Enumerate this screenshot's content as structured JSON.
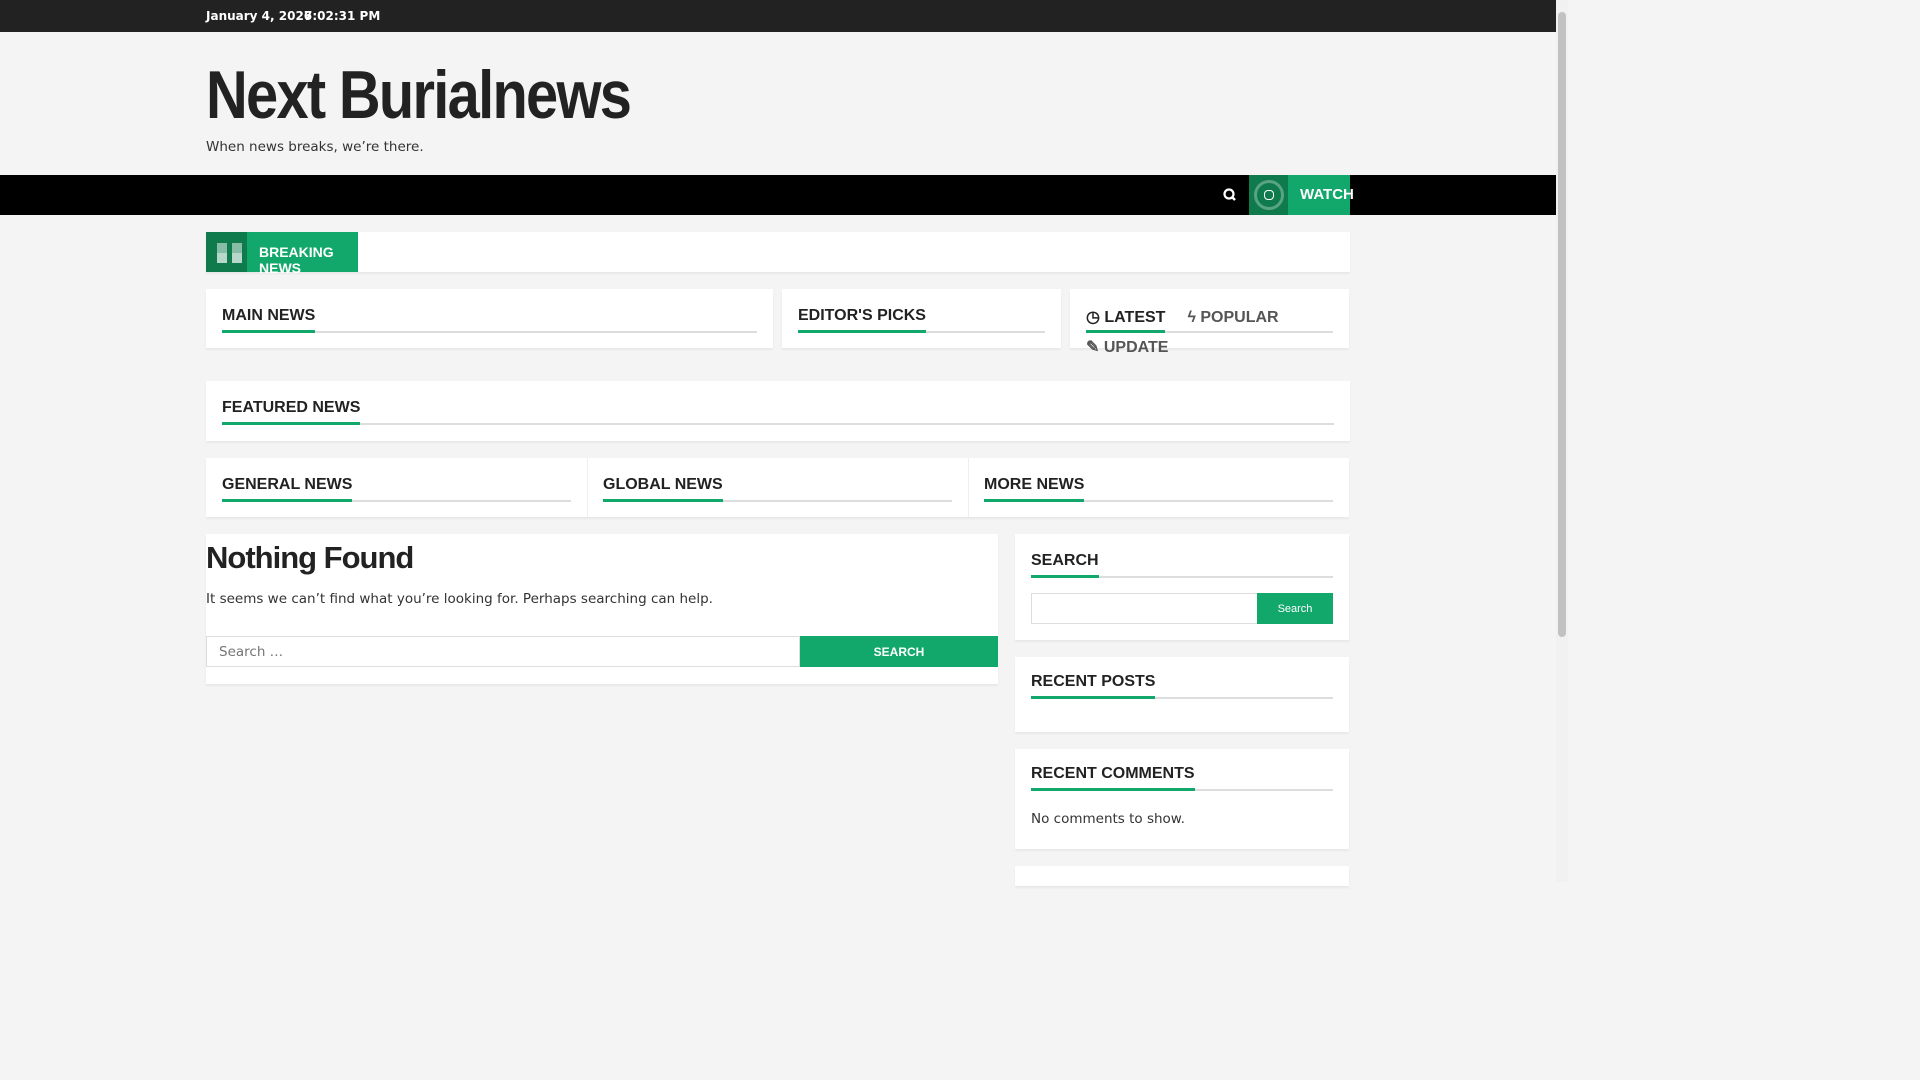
{
  "topbar": {
    "date": "January 4, 2026",
    "time": "7:02:31 PM"
  },
  "site": {
    "title": "Next Burialnews",
    "tagline": "When news breaks, we’re there."
  },
  "nav": {
    "watch_label": "WATCH"
  },
  "breaking": {
    "label": "BREAKING NEWS"
  },
  "sections": {
    "main": "MAIN NEWS",
    "editors": "EDITOR'S PICKS",
    "tabs": [
      "LATEST",
      "POPULAR",
      "UPDATE"
    ],
    "featured": "FEATURED NEWS",
    "general": "GENERAL NEWS",
    "global": "GLOBAL NEWS",
    "more": "MORE NEWS"
  },
  "content": {
    "heading": "Nothing Found",
    "message": "It seems we can’t find what you’re looking for. Perhaps searching can help.",
    "search_placeholder": "Search …",
    "search_button": "SEARCH"
  },
  "sidebar": {
    "search_title": "SEARCH",
    "search_button": "Search",
    "recent_posts": "RECENT POSTS",
    "recent_comments": "RECENT COMMENTS",
    "no_comments": "No comments to show."
  },
  "colors": {
    "accent": "#13a86b",
    "accent_dark": "#0f7b4d"
  }
}
